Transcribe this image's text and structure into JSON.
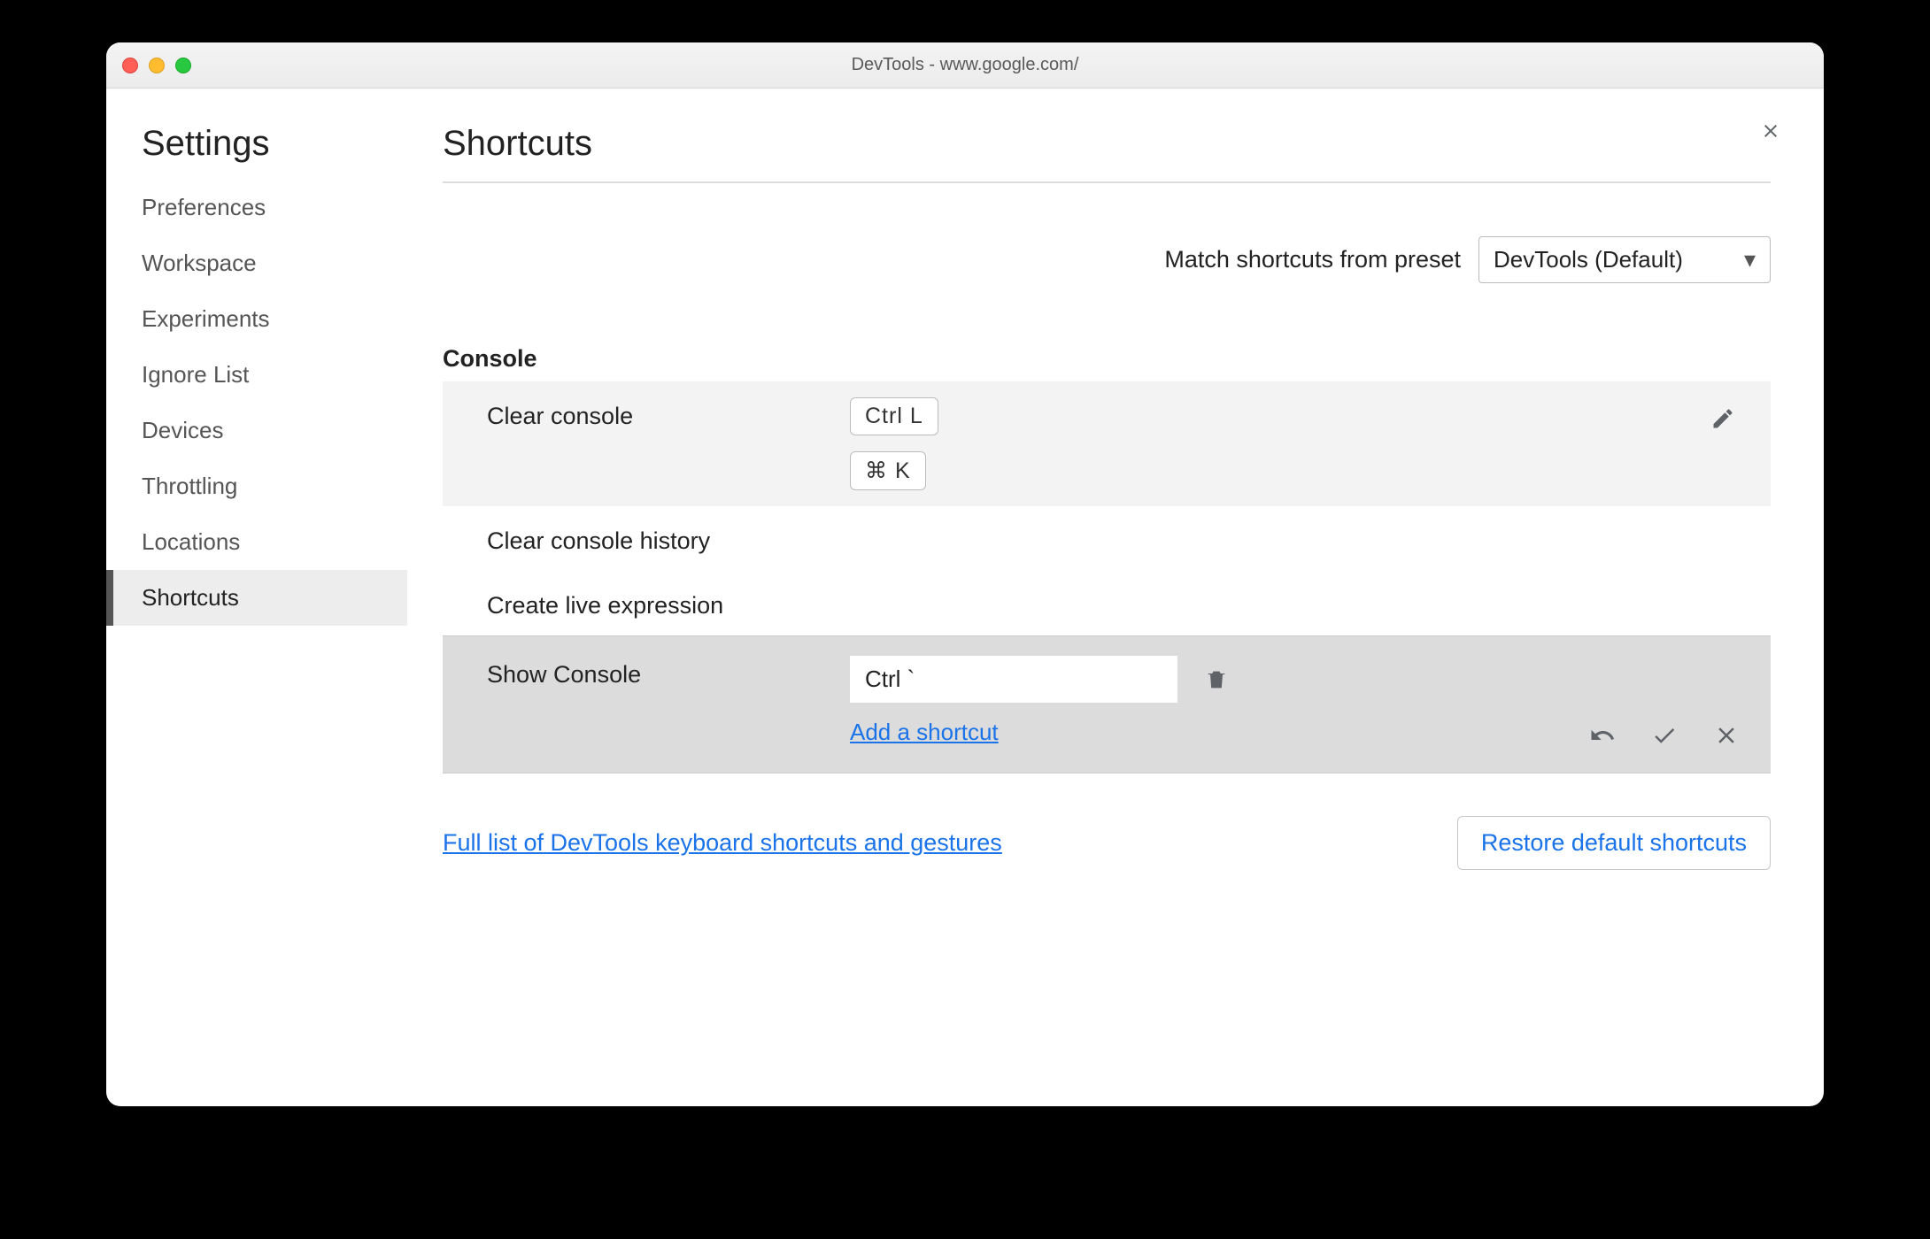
{
  "window": {
    "title": "DevTools - www.google.com/"
  },
  "sidebar": {
    "title": "Settings",
    "items": [
      {
        "label": "Preferences"
      },
      {
        "label": "Workspace"
      },
      {
        "label": "Experiments"
      },
      {
        "label": "Ignore List"
      },
      {
        "label": "Devices"
      },
      {
        "label": "Throttling"
      },
      {
        "label": "Locations"
      },
      {
        "label": "Shortcuts"
      }
    ],
    "active_index": 7
  },
  "main": {
    "title": "Shortcuts",
    "preset_label": "Match shortcuts from preset",
    "preset_value": "DevTools (Default)",
    "section": "Console",
    "rows": {
      "clear_console": {
        "name": "Clear console",
        "keys": [
          "Ctrl L",
          "⌘ K"
        ]
      },
      "clear_history": {
        "name": "Clear console history"
      },
      "create_live": {
        "name": "Create live expression"
      },
      "show_console": {
        "name": "Show Console",
        "input_value": "Ctrl `",
        "add_link": "Add a shortcut"
      }
    },
    "help_link": "Full list of DevTools keyboard shortcuts and gestures",
    "restore_btn": "Restore default shortcuts"
  }
}
